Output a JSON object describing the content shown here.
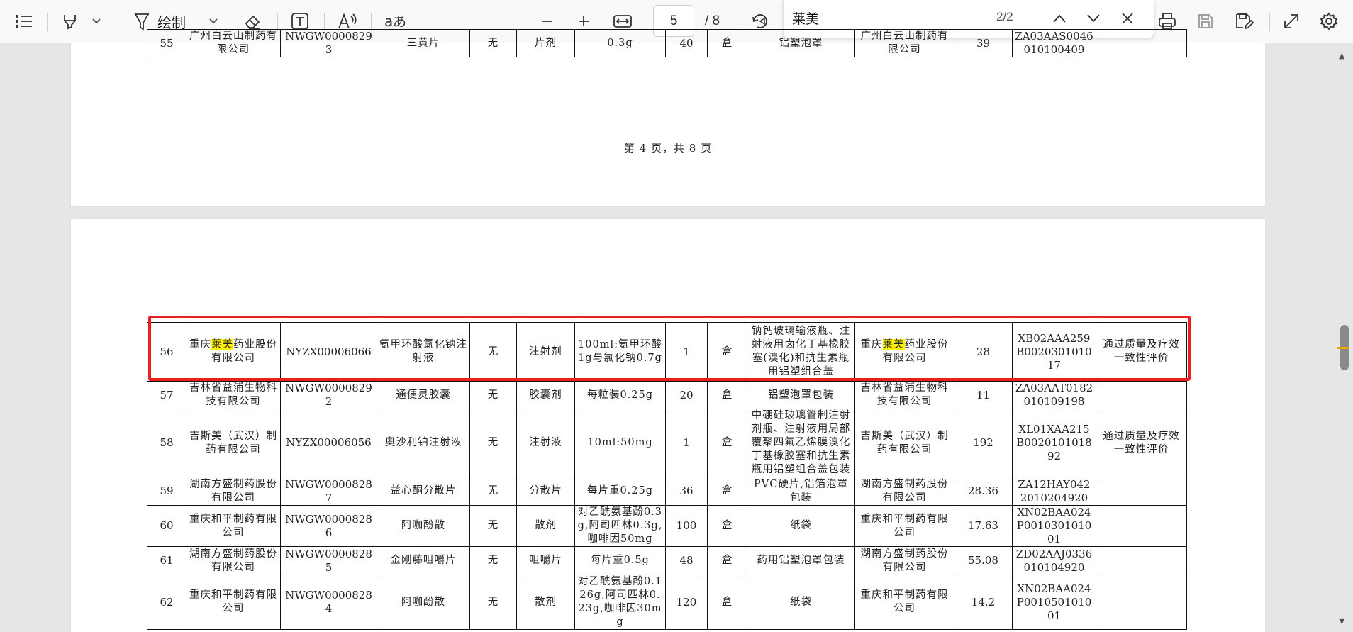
{
  "toolbar": {
    "draw_label": "绘制",
    "current_page": "5",
    "total_pages": "/ 8",
    "search_query": "莱美",
    "search_count": "2/2"
  },
  "page1": {
    "footer": "第 4 页，共 8 页",
    "rows": [
      [
        "55",
        "广州白云山制药有限公司",
        "NWGW00008293",
        "三黄片",
        "无",
        "片剂",
        "0.3g",
        "40",
        "盒",
        "铝塑泡罩",
        "广州白云山制药有限公司",
        "39",
        "ZA03AAS0046010100409",
        ""
      ]
    ]
  },
  "page2": {
    "rows": [
      [
        "56",
        "重庆莱美药业股份有限公司",
        "NYZX00006066",
        "氨甲环酸氯化钠注射液",
        "无",
        "注射剂",
        "100ml:氨甲环酸1g与氯化钠0.7g",
        "1",
        "盒",
        "钠钙玻璃输液瓶、注射液用卤化丁基橡胶塞(溴化)和抗生素瓶用铝塑组合盖",
        "重庆莱美药业股份有限公司",
        "28",
        "XB02AAA259B002030101017",
        "通过质量及疗效一致性评价"
      ],
      [
        "57",
        "吉林省益浦生物科技有限公司",
        "NWGW00008292",
        "通便灵胶囊",
        "无",
        "胶囊剂",
        "每粒装0.25g",
        "20",
        "盒",
        "铝塑泡罩包装",
        "吉林省益浦生物科技有限公司",
        "11",
        "ZA03AAT0182010109198",
        ""
      ],
      [
        "58",
        "吉斯美（武汉）制药有限公司",
        "NYZX00006056",
        "奥沙利铂注射液",
        "无",
        "注射液",
        "10ml:50mg",
        "1",
        "盒",
        "中硼硅玻璃管制注射剂瓶、注射液用局部覆聚四氟乙烯膜溴化丁基橡胶塞和抗生素瓶用铝塑组合盖包装",
        "吉斯美（武汉）制药有限公司",
        "192",
        "XL01XAA215B002010101892",
        "通过质量及疗效一致性评价"
      ],
      [
        "59",
        "湖南方盛制药股份有限公司",
        "NWGW00008287",
        "益心酮分散片",
        "无",
        "分散片",
        "每片重0.25g",
        "36",
        "盒",
        "PVC硬片,铝箔泡罩包装",
        "湖南方盛制药股份有限公司",
        "28.36",
        "ZA12HAY0422010204920",
        ""
      ],
      [
        "60",
        "重庆和平制药有限公司",
        "NWGW00008286",
        "阿咖酚散",
        "无",
        "散剂",
        "对乙酰氨基酚0.3g,阿司匹林0.3g,咖啡因50mg",
        "100",
        "盒",
        "纸袋",
        "重庆和平制药有限公司",
        "17.63",
        "XN02BAA024P001030101001",
        ""
      ],
      [
        "61",
        "湖南方盛制药股份有限公司",
        "NWGW00008285",
        "金刚藤咀嚼片",
        "无",
        "咀嚼片",
        "每片重0.5g",
        "48",
        "盒",
        "药用铝塑泡罩包装",
        "湖南方盛制药股份有限公司",
        "55.08",
        "ZD02AAJ0336010104920",
        ""
      ],
      [
        "62",
        "重庆和平制药有限公司",
        "NWGW00008284",
        "阿咖酚散",
        "无",
        "散剂",
        "对乙酰氨基酚0.126g,阿司匹林0.23g,咖啡因30mg",
        "120",
        "盒",
        "纸袋",
        "重庆和平制药有限公司",
        "14.2",
        "XN02BAA024P001050101001",
        ""
      ]
    ]
  },
  "colors": {
    "highlight_text": "#fff200",
    "highlight_box": "#e8201f"
  }
}
